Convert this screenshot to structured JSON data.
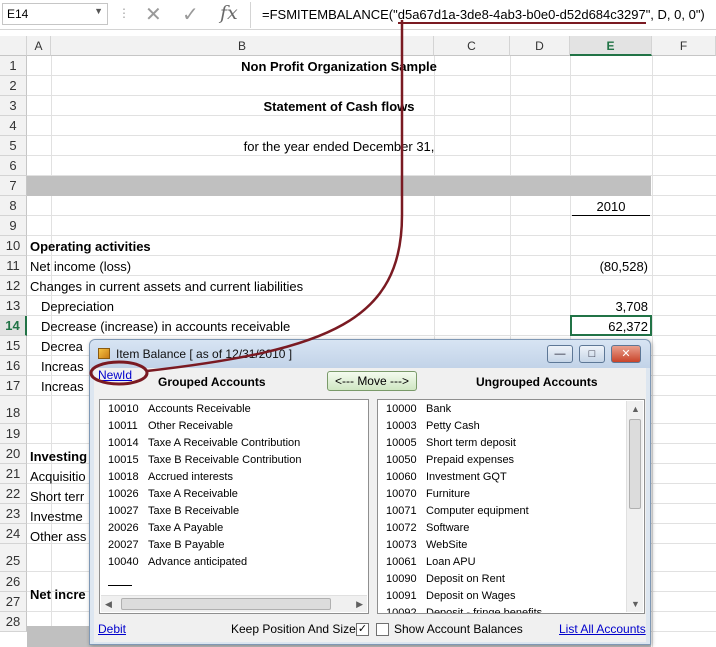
{
  "formula_bar": {
    "name_box": "E14",
    "fx": "fx",
    "formula_prefix": "=FSMITEMBALANCE(\"",
    "formula_guid": "d5a67d1a-3de8-4ab3-b0e0-d52d684c3297",
    "formula_suffix": "\", D, 0, 0\")"
  },
  "columns": [
    "A",
    "B",
    "C",
    "D",
    "E",
    "F"
  ],
  "rows": [
    "1",
    "2",
    "3",
    "4",
    "5",
    "6",
    "7",
    "8",
    "9",
    "10",
    "11",
    "12",
    "13",
    "14",
    "15",
    "16",
    "17",
    "18",
    "19",
    "20",
    "21",
    "22",
    "23",
    "24",
    "25",
    "26",
    "27",
    "28"
  ],
  "sheet": {
    "title": "Non Profit Organization Sample",
    "subtitle": "Statement of Cash flows",
    "period": "for the year ended December 31,",
    "year": "2010",
    "operating": "Operating activities",
    "net_income": "Net income (loss)",
    "net_income_val": "(80,528)",
    "changes": "Changes in current assets and current liabilities",
    "depreciation": "Depreciation",
    "depreciation_val": "3,708",
    "decrease_ar": "Decrease (increase) in accounts receivable",
    "decrease_ar_val": "62,372",
    "r15": "Decrea",
    "r16": "Increas",
    "r17": "Increas",
    "r20": "Investing",
    "r21": "Acquisitio",
    "r22": "Short terr",
    "r23": "Investme",
    "r24": "Other ass",
    "r26": "Net incre"
  },
  "dialog": {
    "title": "Item Balance [ as of 12/31/2010 ]",
    "new_id": "NewId",
    "grouped_header": "Grouped Accounts",
    "move_button": "<--- Move --->",
    "ungrouped_header": "Ungrouped Accounts",
    "grouped": [
      {
        "code": "10010",
        "name": "Accounts Receivable"
      },
      {
        "code": "10011",
        "name": "Other Receivable"
      },
      {
        "code": "10014",
        "name": "Taxe A Receivable Contribution"
      },
      {
        "code": "10015",
        "name": "Taxe B Receivable Contribution"
      },
      {
        "code": "10018",
        "name": "Accrued interests"
      },
      {
        "code": "10026",
        "name": "Taxe A Receivable"
      },
      {
        "code": "10027",
        "name": "Taxe B Receivable"
      },
      {
        "code": "20026",
        "name": "Taxe A Payable"
      },
      {
        "code": "20027",
        "name": "Taxe B Payable"
      },
      {
        "code": "10040",
        "name": "Advance anticipated"
      }
    ],
    "ungrouped": [
      {
        "code": "10000",
        "name": "Bank"
      },
      {
        "code": "10003",
        "name": "Petty Cash"
      },
      {
        "code": "10005",
        "name": "Short term deposit"
      },
      {
        "code": "10050",
        "name": "Prepaid expenses"
      },
      {
        "code": "10060",
        "name": "Investment GQT"
      },
      {
        "code": "10070",
        "name": "Furniture"
      },
      {
        "code": "10071",
        "name": "Computer equipment"
      },
      {
        "code": "10072",
        "name": "Software"
      },
      {
        "code": "10073",
        "name": "WebSite"
      },
      {
        "code": "10061",
        "name": "Loan APU"
      },
      {
        "code": "10090",
        "name": "Deposit on Rent"
      },
      {
        "code": "10091",
        "name": "Deposit on Wages"
      },
      {
        "code": "10092",
        "name": "Deposit - fringe benefits"
      }
    ],
    "debit": "Debit",
    "keep_position": "Keep Position And Size",
    "keep_checked": "✓",
    "show_balances": "Show Account Balances",
    "list_all": "List All Accounts",
    "minimize": "—",
    "maximize": "□",
    "close": "✕"
  },
  "colors": {
    "accent": "#217346",
    "annotation": "#7a1a22"
  }
}
